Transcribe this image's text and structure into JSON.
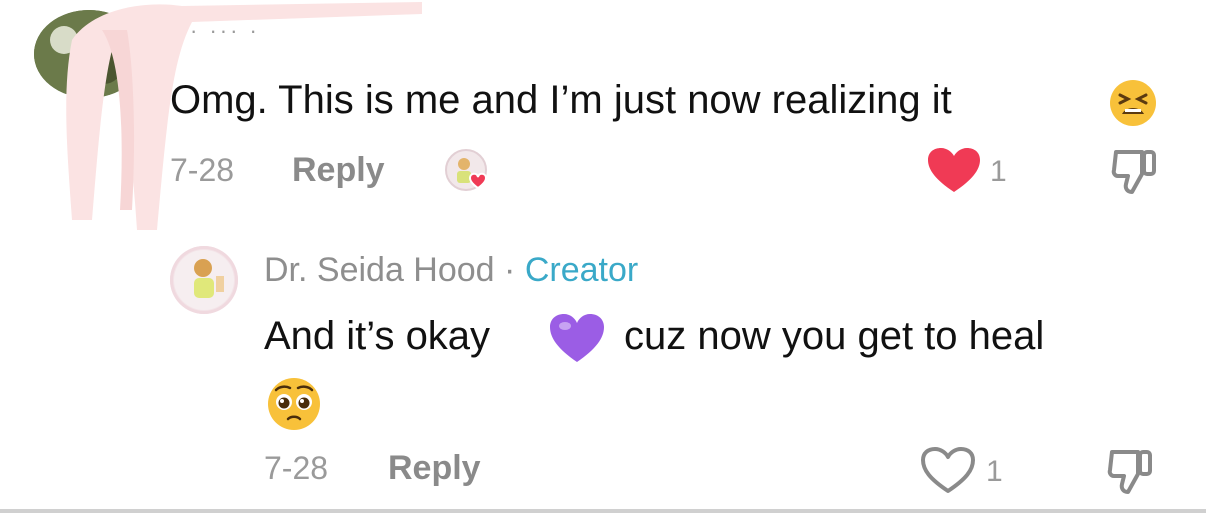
{
  "comment": {
    "username": "· ··· ·",
    "text": "Omg. This is me and I’m just now realizing it",
    "emoji": "tired-face-emoji",
    "date": "7-28",
    "reply_label": "Reply",
    "liked_by_creator": true,
    "liked": true,
    "like_count": "1"
  },
  "reply": {
    "author": "Dr. Seida Hood",
    "separator": "·",
    "badge": "Creator",
    "text_part1": "And it’s okay",
    "emoji_inline": "purple-heart-emoji",
    "text_part2": "cuz now you get to heal",
    "emoji_trailing": "pleading-face-emoji",
    "date": "7-28",
    "reply_label": "Reply",
    "liked": false,
    "like_count": "1"
  },
  "colors": {
    "text": "#111111",
    "meta": "#9a9a9a",
    "like_red": "#f03a55",
    "creator_blue": "#3aa9c8",
    "purple_heart": "#9b5de5",
    "redaction_pink": "#fbe3e3"
  }
}
